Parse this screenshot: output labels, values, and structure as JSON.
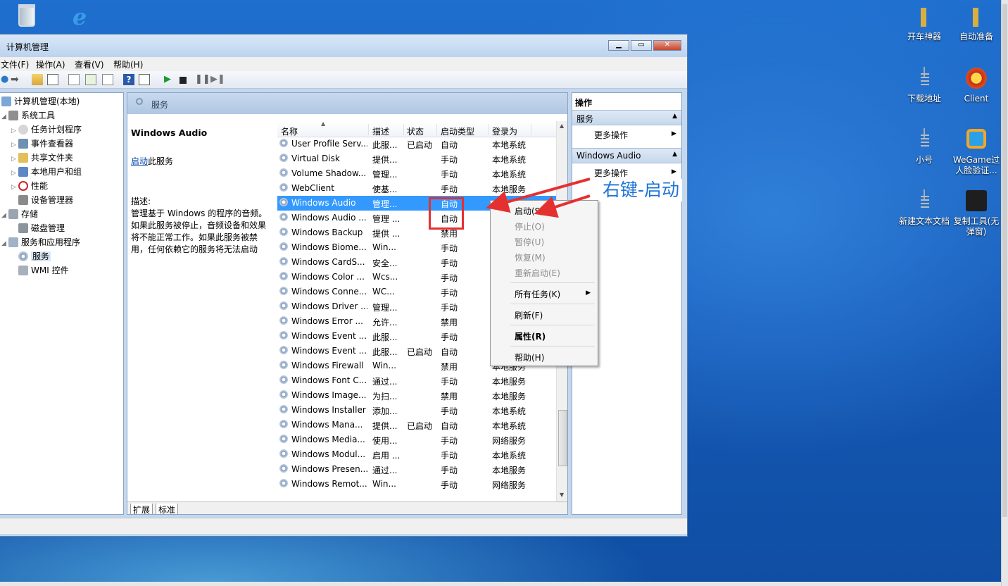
{
  "window": {
    "title": "计算机管理",
    "menu": [
      "文件(F)",
      "操作(A)",
      "查看(V)",
      "帮助(H)"
    ]
  },
  "desktop_icons": [
    {
      "name": "开车神器",
      "icon": "folder-icon"
    },
    {
      "name": "自动准备",
      "icon": "folder-icon"
    },
    {
      "name": "下载地址",
      "icon": "document-icon"
    },
    {
      "name": "Client",
      "icon": "client-logo-icon"
    },
    {
      "name": "小号",
      "icon": "document-icon"
    },
    {
      "name": "WeGame过人脸验证...",
      "icon": "wegame-icon"
    },
    {
      "name": "新建文本文档",
      "icon": "document-icon"
    },
    {
      "name": "复制工具(无弹窗)",
      "icon": "tools-icon"
    }
  ],
  "tree": [
    {
      "label": "计算机管理(本地)"
    },
    {
      "label": "系统工具"
    },
    {
      "label": "任务计划程序"
    },
    {
      "label": "事件查看器"
    },
    {
      "label": "共享文件夹"
    },
    {
      "label": "本地用户和组"
    },
    {
      "label": "性能"
    },
    {
      "label": "设备管理器"
    },
    {
      "label": "存储"
    },
    {
      "label": "磁盘管理"
    },
    {
      "label": "服务和应用程序"
    },
    {
      "label": "服务"
    },
    {
      "label": "WMI 控件"
    }
  ],
  "center": {
    "header": "服务",
    "selected_service": "Windows Audio",
    "start_link": "启动",
    "start_suffix": "此服务",
    "desc_label": "描述:",
    "desc_text": "管理基于 Windows 的程序的音频。如果此服务被停止，音频设备和效果将不能正常工作。如果此服务被禁用，任何依赖它的服务将无法启动",
    "columns": [
      "名称",
      "描述",
      "状态",
      "启动类型",
      "登录为"
    ],
    "rows": [
      [
        "User Profile Serv...",
        "此服...",
        "已启动",
        "自动",
        "本地系统"
      ],
      [
        "Virtual Disk",
        "提供...",
        "",
        "手动",
        "本地系统"
      ],
      [
        "Volume Shadow...",
        "管理...",
        "",
        "手动",
        "本地系统"
      ],
      [
        "WebClient",
        "使基...",
        "",
        "手动",
        "本地服务"
      ],
      [
        "Windows Audio",
        "管理...",
        "",
        "自动",
        ""
      ],
      [
        "Windows Audio ...",
        "管理 ...",
        "",
        "自动",
        ""
      ],
      [
        "Windows Backup",
        "提供 ...",
        "",
        "禁用",
        ""
      ],
      [
        "Windows Biome...",
        "Win...",
        "",
        "手动",
        ""
      ],
      [
        "Windows CardS...",
        "安全...",
        "",
        "手动",
        ""
      ],
      [
        "Windows Color ...",
        "Wcs...",
        "",
        "手动",
        ""
      ],
      [
        "Windows Conne...",
        "WC...",
        "",
        "手动",
        ""
      ],
      [
        "Windows Driver ...",
        "管理...",
        "",
        "手动",
        ""
      ],
      [
        "Windows Error ...",
        "允许...",
        "",
        "禁用",
        ""
      ],
      [
        "Windows Event ...",
        "此服...",
        "",
        "手动",
        ""
      ],
      [
        "Windows Event ...",
        "此服...",
        "已启动",
        "自动",
        ""
      ],
      [
        "Windows Firewall",
        "Win...",
        "",
        "禁用",
        "本地服务"
      ],
      [
        "Windows Font C...",
        "通过...",
        "",
        "手动",
        "本地服务"
      ],
      [
        "Windows Image...",
        "为扫...",
        "",
        "禁用",
        "本地服务"
      ],
      [
        "Windows Installer",
        "添加...",
        "",
        "手动",
        "本地系统"
      ],
      [
        "Windows Mana...",
        "提供...",
        "已启动",
        "自动",
        "本地系统"
      ],
      [
        "Windows Media...",
        "使用...",
        "",
        "手动",
        "网络服务"
      ],
      [
        "Windows Modul...",
        "启用 ...",
        "",
        "手动",
        "本地系统"
      ],
      [
        "Windows Presen...",
        "通过...",
        "",
        "手动",
        "本地服务"
      ],
      [
        "Windows Remot...",
        "Win...",
        "",
        "手动",
        "网络服务"
      ]
    ],
    "tabs": [
      "扩展",
      "标准"
    ]
  },
  "actions": {
    "header": "操作",
    "section1": "服务",
    "more1": "更多操作",
    "section2": "Windows Audio",
    "more2": "更多操作"
  },
  "context_menu": {
    "start": "启动(S)",
    "stop": "停止(O)",
    "pause": "暂停(U)",
    "resume": "恢复(M)",
    "restart": "重新启动(E)",
    "all_tasks": "所有任务(K)",
    "refresh": "刷新(F)",
    "properties": "属性(R)",
    "help": "帮助(H)"
  },
  "annotation": "右键-启动",
  "colors": {
    "selection": "#3399ff",
    "annotation_red": "#e53030",
    "annotation_blue": "#1d73d6"
  }
}
